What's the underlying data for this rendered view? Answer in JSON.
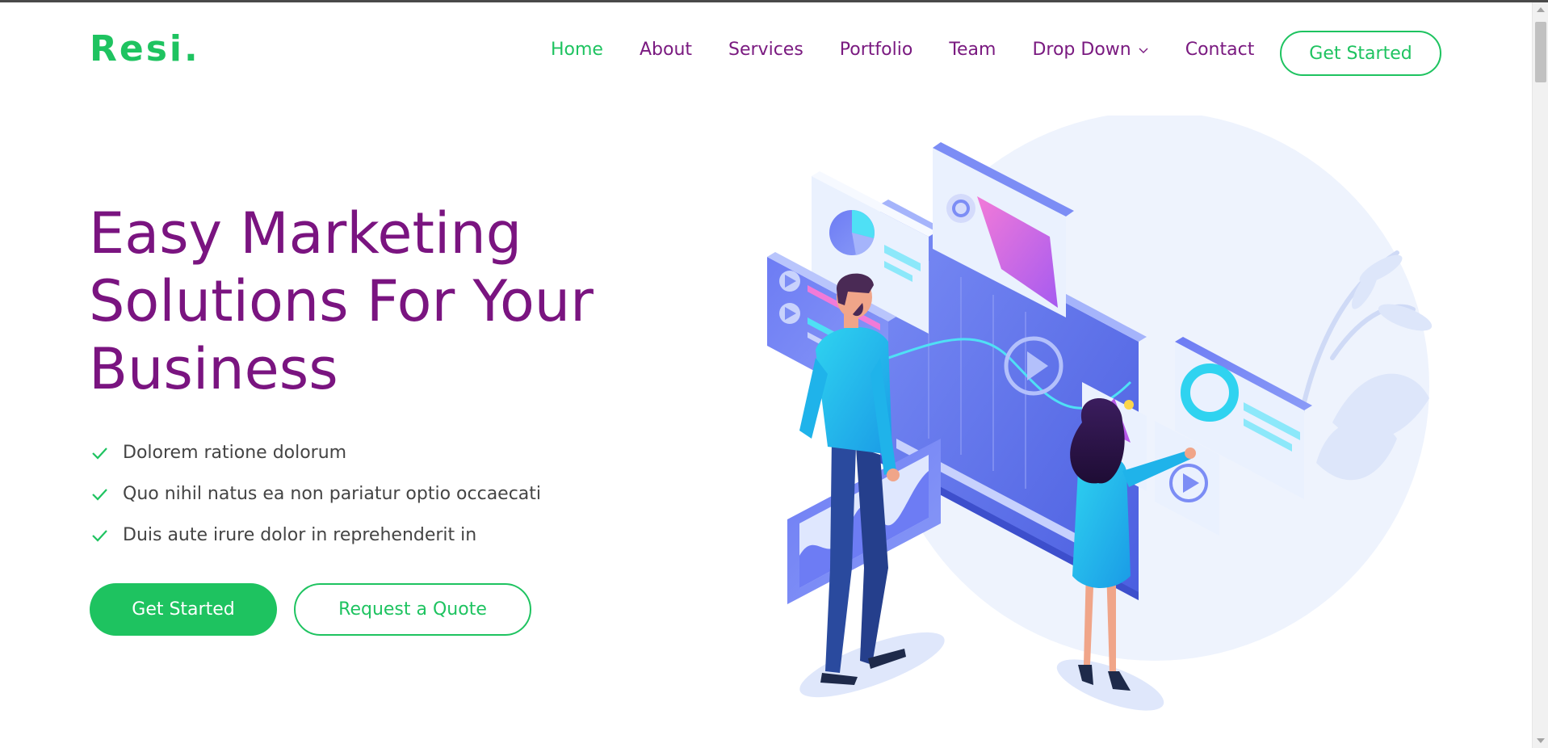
{
  "brand": {
    "logo": "Resi."
  },
  "nav": {
    "items": [
      {
        "label": "Home",
        "active": true
      },
      {
        "label": "About",
        "active": false
      },
      {
        "label": "Services",
        "active": false
      },
      {
        "label": "Portfolio",
        "active": false
      },
      {
        "label": "Team",
        "active": false
      },
      {
        "label": "Drop Down",
        "active": false
      },
      {
        "label": "Contact",
        "active": false
      }
    ],
    "cta": "Get Started"
  },
  "hero": {
    "title_lines": [
      "Easy Marketing",
      "Solutions For Your",
      "Business"
    ],
    "features": [
      "Dolorem ratione dolorum",
      "Quo nihil natus ea non pariatur optio occaecati",
      "Duis aute irure dolor in reprehenderit in"
    ],
    "primary_button": "Get Started",
    "secondary_button": "Request a Quote"
  },
  "icons": {
    "dropdown": "chevron-down-icon",
    "feature": "check-icon"
  },
  "colors": {
    "accent_green": "#1ec360",
    "heading_purple": "#7a1480",
    "nav_purple": "#7a1a80",
    "body_text": "#444444"
  }
}
